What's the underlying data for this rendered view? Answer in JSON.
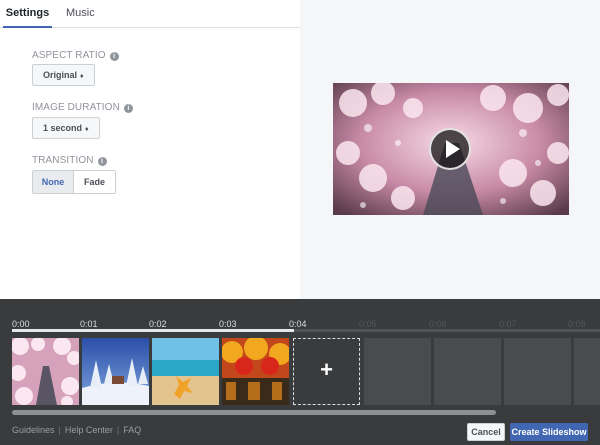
{
  "tabs": [
    {
      "label": "Settings",
      "active": true
    },
    {
      "label": "Music",
      "active": false
    }
  ],
  "settings": {
    "aspect_ratio": {
      "label": "ASPECT RATIO",
      "value": "Original"
    },
    "image_duration": {
      "label": "IMAGE DURATION",
      "value": "1 second"
    },
    "transition": {
      "label": "TRANSITION",
      "options": [
        "None",
        "Fade"
      ],
      "selected": "None"
    },
    "caret": "♦",
    "info_glyph": "i"
  },
  "timeline": {
    "ticks": [
      "0:00",
      "0:01",
      "0:02",
      "0:03",
      "0:04",
      "0:05",
      "0:06",
      "0:07",
      "0:08"
    ],
    "add_glyph": "+",
    "images": [
      "cherry-blossom-canal",
      "snowy-forest-cabin",
      "starfish-beach",
      "autumn-forest-lake"
    ]
  },
  "footer": {
    "links": [
      "Guidelines",
      "Help Center",
      "FAQ"
    ],
    "cancel_label": "Cancel",
    "create_label": "Create Slideshow"
  },
  "icons": {
    "play": "play-icon",
    "info": "info-icon",
    "add": "plus-icon"
  },
  "colors": {
    "accent": "#4267b2",
    "timeline_bg": "#3a3b3c"
  }
}
